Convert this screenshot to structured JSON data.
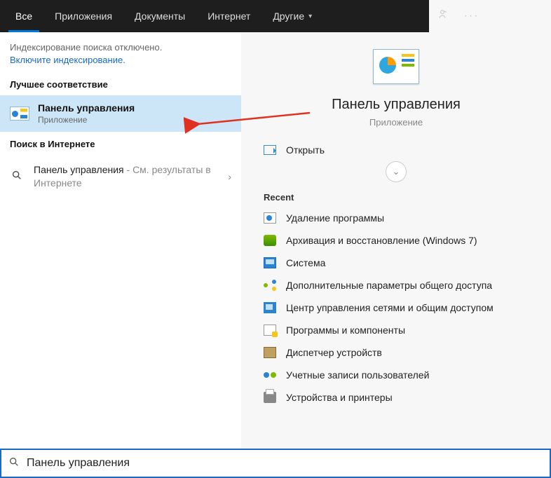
{
  "tabs": {
    "items": [
      {
        "label": "Все",
        "active": true
      },
      {
        "label": "Приложения"
      },
      {
        "label": "Документы"
      },
      {
        "label": "Интернет"
      },
      {
        "label": "Другие",
        "dropdown": true
      }
    ]
  },
  "notice": {
    "line1": "Индексирование поиска отключено.",
    "link": "Включите индексирование."
  },
  "best_match_title": "Лучшее соответствие",
  "best_match": {
    "title": "Панель управления",
    "subtitle": "Приложение"
  },
  "web_section_title": "Поиск в Интернете",
  "web_result": {
    "title": "Панель управления",
    "suffix": " - См. результаты в Интернете"
  },
  "preview": {
    "title": "Панель управления",
    "subtitle": "Приложение",
    "open": "Открыть",
    "recent_title": "Recent",
    "recent": [
      "Удаление программы",
      "Архивация и восстановление (Windows 7)",
      "Система",
      "Дополнительные параметры общего доступа",
      "Центр управления сетями и общим доступом",
      "Программы и компоненты",
      "Диспетчер устройств",
      "Учетные записи пользователей",
      "Устройства и принтеры"
    ]
  },
  "search_value": "Панель управления"
}
